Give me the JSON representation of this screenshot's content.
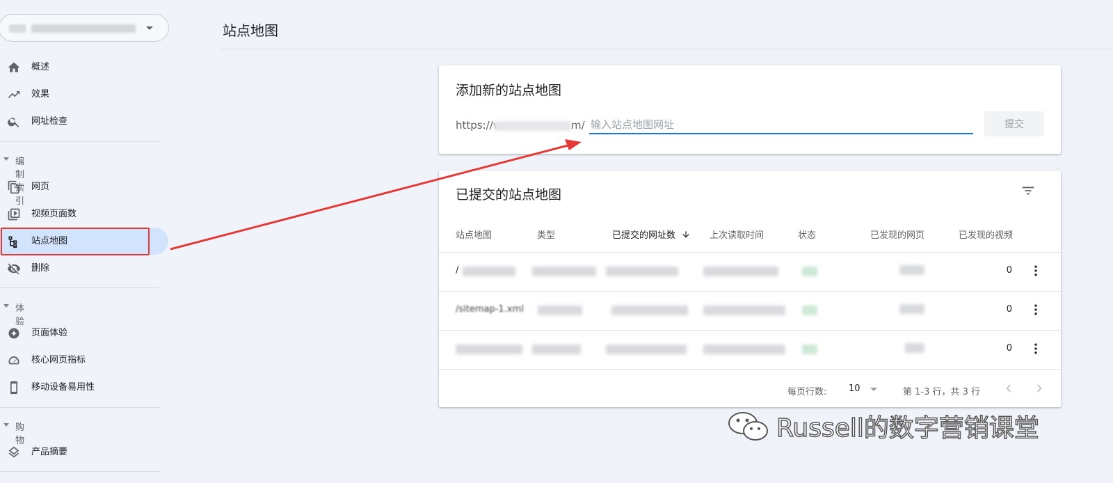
{
  "sidebar": {
    "items": [
      {
        "label": "概述"
      },
      {
        "label": "效果"
      },
      {
        "label": "网址检查"
      }
    ],
    "sections": [
      {
        "label": "编制索引",
        "items": [
          {
            "label": "网页"
          },
          {
            "label": "视频页面数"
          },
          {
            "label": "站点地图"
          },
          {
            "label": "删除"
          }
        ]
      },
      {
        "label": "体验",
        "items": [
          {
            "label": "页面体验"
          },
          {
            "label": "核心网页指标"
          },
          {
            "label": "移动设备易用性"
          }
        ]
      },
      {
        "label": "购物",
        "items": [
          {
            "label": "产品摘要"
          }
        ]
      }
    ],
    "active_item": "站点地图"
  },
  "header": {
    "title": "站点地图"
  },
  "add_card": {
    "title": "添加新的站点地图",
    "url_prefix": "https://v",
    "url_suffix": "m/",
    "input_placeholder": "输入站点地图网址",
    "submit_label": "提交"
  },
  "list_card": {
    "title": "已提交的站点地图",
    "columns": [
      "站点地图",
      "类型",
      "已提交的网址数",
      "上次读取时间",
      "状态",
      "已发现的网页",
      "已发现的视频"
    ],
    "rows": [
      {
        "sitemap": "/",
        "videos": "0"
      },
      {
        "sitemap": "/sitemap-1.xml",
        "videos": "0"
      },
      {
        "sitemap": "",
        "videos": "0"
      }
    ],
    "pagination": {
      "rows_per_page_label": "每页行数:",
      "rows_per_page_value": "10",
      "range_text": "第 1-3 行，共 3 行"
    }
  },
  "watermark": {
    "text": "Russell的数字营销课堂"
  },
  "colors": {
    "accent": "#1a73e8",
    "active_bg": "#d2e3fc",
    "annotation": "#e53935"
  }
}
